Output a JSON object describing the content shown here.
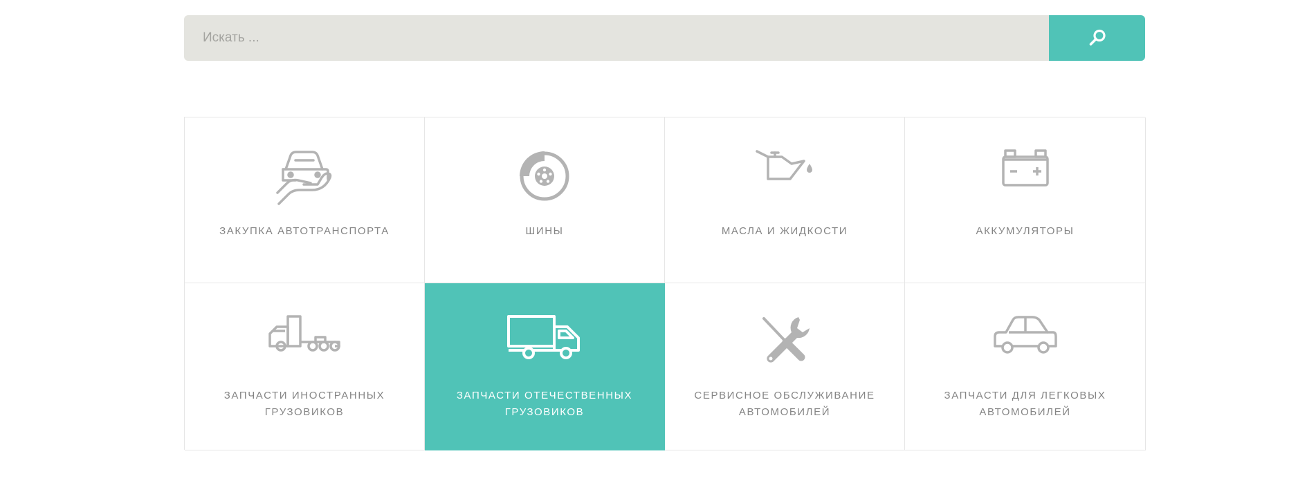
{
  "search": {
    "placeholder": "Искать ...",
    "button_icon": "search-icon"
  },
  "colors": {
    "accent": "#50c3b7",
    "search_bg": "#e4e4df",
    "icon_gray": "#b3b3b3",
    "label_gray": "#858585",
    "border": "#e6e6e6"
  },
  "categories": [
    {
      "label": "Закупка автотранспорта",
      "icon": "car-in-hand-icon",
      "active": false
    },
    {
      "label": "Шины",
      "icon": "brake-disc-icon",
      "active": false
    },
    {
      "label": "Масла и жидкости",
      "icon": "oil-can-icon",
      "active": false
    },
    {
      "label": "Аккумуляторы",
      "icon": "battery-icon",
      "active": false
    },
    {
      "label": "Запчасти иностранных грузовиков",
      "icon": "semi-truck-icon",
      "active": false
    },
    {
      "label": "Запчасти отечественных грузовиков",
      "icon": "delivery-truck-icon",
      "active": true
    },
    {
      "label": "Сервисное обслуживание автомобилей",
      "icon": "wrench-screwdriver-icon",
      "active": false
    },
    {
      "label": "Запчасти для легковых автомобилей",
      "icon": "car-icon",
      "active": false
    }
  ]
}
